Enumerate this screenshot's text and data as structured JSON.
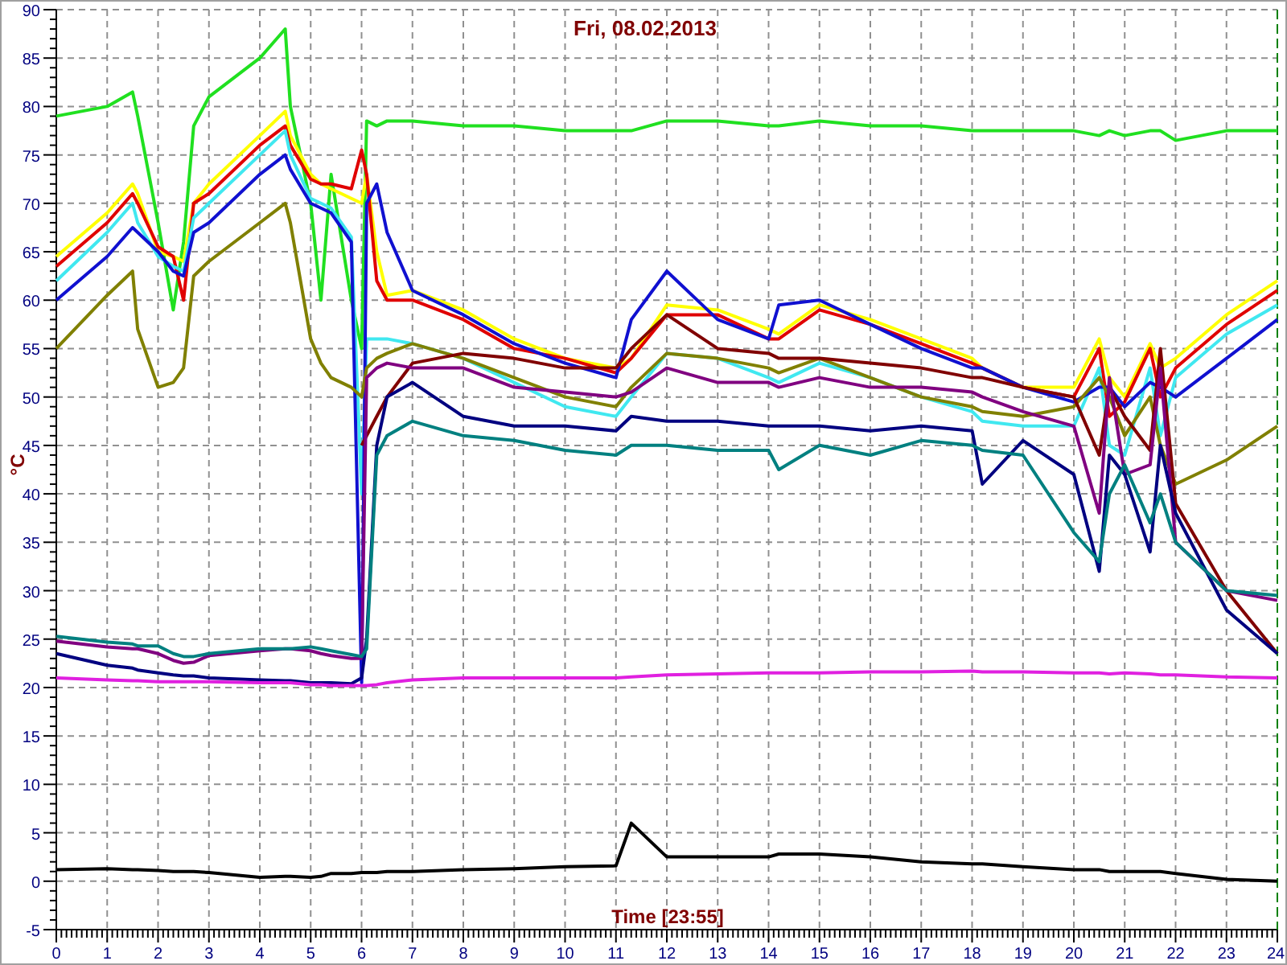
{
  "chart_data": {
    "type": "line",
    "grid": true,
    "title": "Fri, 08.02.2013",
    "xlabel": "Time [23:55]",
    "ylabel": "°C",
    "xlim": [
      0,
      24
    ],
    "ylim": [
      -5,
      90
    ],
    "xticks": [
      0,
      1,
      2,
      3,
      4,
      5,
      6,
      7,
      8,
      9,
      10,
      11,
      12,
      13,
      14,
      15,
      16,
      17,
      18,
      19,
      20,
      21,
      22,
      23,
      24
    ],
    "yticks": [
      -5,
      0,
      5,
      10,
      15,
      20,
      25,
      30,
      35,
      40,
      45,
      50,
      55,
      60,
      65,
      70,
      75,
      80,
      85,
      90
    ],
    "x": [
      0,
      1,
      1.5,
      1.6,
      2,
      2.3,
      2.5,
      2.7,
      3,
      4,
      4.5,
      4.6,
      5,
      5.2,
      5.4,
      5.8,
      6,
      6.1,
      6.3,
      6.5,
      7,
      8,
      9,
      10,
      11,
      11.3,
      12,
      13,
      14,
      14.2,
      15,
      16,
      17,
      18,
      18.2,
      19,
      20,
      20.5,
      20.7,
      21,
      21.5,
      21.7,
      22,
      23,
      24
    ],
    "series": [
      {
        "color": "#20e020",
        "values": [
          79,
          80,
          81.5,
          79,
          68,
          59,
          66,
          78,
          81,
          85,
          88,
          80,
          70,
          60,
          73,
          60,
          55,
          78.5,
          78,
          78.5,
          78.5,
          78,
          78,
          77.5,
          77.5,
          77.5,
          78.5,
          78.5,
          78,
          78,
          78.5,
          78,
          78,
          77.5,
          77.5,
          77.5,
          77.5,
          77,
          77.5,
          77,
          77.5,
          77.5,
          76.5,
          77.5,
          77.5
        ]
      },
      {
        "color": "#ffff00",
        "values": [
          64.5,
          69,
          72,
          71,
          65,
          64.5,
          64,
          70,
          72,
          77,
          79.5,
          77,
          73,
          72,
          71.5,
          70.5,
          70,
          73,
          65,
          60.5,
          61,
          59,
          56,
          54,
          53,
          54,
          59.5,
          59,
          57,
          56.5,
          59.5,
          58,
          56,
          54,
          53,
          51,
          51,
          56,
          52,
          50,
          55.5,
          53,
          54,
          58.5,
          62
        ]
      },
      {
        "color": "#e00000",
        "values": [
          63.5,
          68,
          71,
          70,
          65.5,
          64.5,
          60,
          70,
          71,
          76,
          78,
          76,
          72.5,
          72,
          72,
          71.5,
          75.5,
          73,
          62,
          60,
          60,
          58,
          55,
          54,
          52.5,
          54,
          58.5,
          58.5,
          56,
          56,
          59,
          57.5,
          55.5,
          53.5,
          53,
          51,
          50,
          55,
          48,
          49.5,
          55,
          50,
          53,
          57.5,
          61
        ]
      },
      {
        "color": "#40e8f0",
        "values": [
          62,
          67,
          70,
          68,
          64.5,
          63.5,
          63,
          68.5,
          70,
          75,
          77.5,
          75,
          70.5,
          70,
          69.5,
          66.5,
          40,
          56,
          56,
          56,
          55.5,
          54,
          51.5,
          49,
          48,
          50,
          54.5,
          54,
          52,
          51.5,
          53.5,
          52,
          50,
          48.5,
          47.5,
          47,
          47,
          53,
          45,
          44,
          53,
          46,
          52,
          56.5,
          59.5
        ]
      },
      {
        "color": "#1010d0",
        "values": [
          60,
          64.5,
          67.5,
          67,
          65,
          63,
          62.5,
          67,
          68,
          73,
          75,
          73.5,
          70,
          69.5,
          69,
          66,
          20.5,
          70,
          72,
          67,
          61,
          58.5,
          55.5,
          53.5,
          52,
          58,
          63,
          58,
          56,
          59.5,
          60,
          57.5,
          55,
          53,
          53,
          51,
          49.5,
          51,
          51,
          49,
          51.5,
          51,
          50,
          54,
          58
        ]
      },
      {
        "color": "#808000",
        "values": [
          55,
          60.5,
          63,
          57,
          51,
          51.5,
          53,
          62.5,
          64,
          68,
          70,
          68,
          56,
          53.5,
          52,
          51,
          50,
          53,
          54,
          54.5,
          55.5,
          54,
          52,
          50,
          49,
          51,
          54.5,
          54,
          53,
          52.5,
          54,
          52,
          50,
          49,
          48.5,
          48,
          49,
          52,
          50,
          46,
          50,
          45,
          41,
          43.5,
          47
        ]
      },
      {
        "color": "#800000",
        "values": [
          null,
          null,
          null,
          null,
          null,
          null,
          null,
          null,
          null,
          null,
          null,
          null,
          null,
          null,
          null,
          null,
          45,
          46,
          48,
          50,
          53.5,
          54.5,
          54,
          53,
          53,
          55,
          58.5,
          55,
          54.5,
          54,
          54,
          53.5,
          53,
          52,
          52,
          51,
          50,
          44,
          51,
          48,
          44.5,
          55,
          39,
          30,
          23.5
        ]
      },
      {
        "color": "#800080",
        "values": [
          24.8,
          24.2,
          24,
          24,
          23.5,
          22.8,
          22.5,
          22.6,
          23.3,
          23.8,
          24,
          24,
          23.8,
          23.5,
          23.3,
          23,
          23,
          52,
          53,
          53.5,
          53,
          53,
          51,
          50.5,
          50,
          50.5,
          53,
          51.5,
          51.5,
          51,
          52,
          51,
          51,
          50.5,
          50,
          48.5,
          47,
          38,
          52,
          42,
          43,
          53,
          35,
          30,
          29
        ]
      },
      {
        "color": "#000080",
        "values": [
          23.5,
          22.3,
          22,
          21.8,
          21.5,
          21.3,
          21.2,
          21.2,
          21,
          20.8,
          20.7,
          20.7,
          20.5,
          20.5,
          20.5,
          20.4,
          21,
          25,
          45,
          50,
          51.5,
          48,
          47,
          47,
          46.5,
          48,
          47.5,
          47.5,
          47,
          47,
          47,
          46.5,
          47,
          46.5,
          41,
          45.5,
          42,
          32,
          44,
          42,
          34,
          45,
          38,
          28,
          23.5
        ]
      },
      {
        "color": "#008080",
        "values": [
          25.3,
          24.7,
          24.5,
          24.3,
          24.3,
          23.5,
          23.2,
          23.2,
          23.5,
          24,
          24,
          24,
          24.2,
          24,
          23.8,
          23.4,
          23.2,
          24,
          44,
          46,
          47.5,
          46,
          45.5,
          44.5,
          44,
          45,
          45,
          44.5,
          44.5,
          42.5,
          45,
          44,
          45.5,
          45,
          44.5,
          44,
          36,
          33,
          40,
          43,
          37,
          40,
          35,
          30,
          29.5
        ]
      },
      {
        "color": "#e020e0",
        "values": [
          21,
          20.8,
          20.7,
          20.7,
          20.6,
          20.6,
          20.6,
          20.6,
          20.6,
          20.5,
          20.5,
          20.5,
          20.3,
          20.3,
          20.2,
          20.2,
          20.2,
          20.2,
          20.3,
          20.5,
          20.8,
          21,
          21,
          21,
          21,
          21.1,
          21.3,
          21.4,
          21.5,
          21.5,
          21.5,
          21.6,
          21.6,
          21.7,
          21.6,
          21.6,
          21.5,
          21.5,
          21.4,
          21.5,
          21.4,
          21.3,
          21.3,
          21.1,
          21
        ]
      },
      {
        "color": "#000000",
        "values": [
          1.2,
          1.3,
          1.2,
          1.2,
          1.1,
          1,
          1,
          1,
          0.9,
          0.4,
          0.5,
          0.5,
          0.4,
          0.5,
          0.8,
          0.8,
          0.9,
          0.9,
          0.9,
          1,
          1,
          1.2,
          1.3,
          1.5,
          1.6,
          6,
          2.5,
          2.5,
          2.5,
          2.8,
          2.8,
          2.5,
          2,
          1.8,
          1.8,
          1.5,
          1.2,
          1.2,
          1,
          1,
          1,
          1,
          0.8,
          0.2,
          0
        ]
      }
    ]
  }
}
